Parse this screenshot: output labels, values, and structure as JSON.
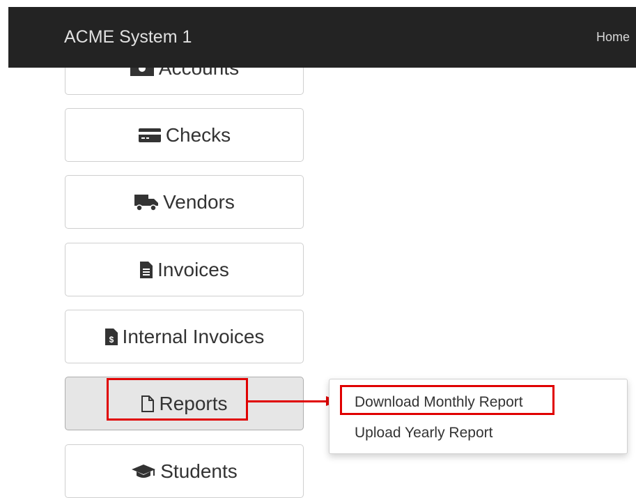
{
  "app": {
    "brand": "ACME System 1"
  },
  "nav": {
    "home": "Home"
  },
  "sidebar": {
    "items": [
      {
        "label": "Accounts",
        "icon": "money-icon"
      },
      {
        "label": "Checks",
        "icon": "credit-card-icon"
      },
      {
        "label": "Vendors",
        "icon": "truck-icon"
      },
      {
        "label": "Invoices",
        "icon": "file-text-icon"
      },
      {
        "label": "Internal Invoices",
        "icon": "file-invoice-dollar-icon"
      },
      {
        "label": "Reports",
        "icon": "file-icon",
        "active": true
      },
      {
        "label": "Students",
        "icon": "graduation-cap-icon"
      }
    ]
  },
  "reports_menu": {
    "items": [
      {
        "label": "Download Monthly Report",
        "highlighted": true
      },
      {
        "label": "Upload Yearly Report"
      }
    ]
  },
  "colors": {
    "topbar": "#232323",
    "annotation": "#e00000",
    "active_button": "#e6e6e6"
  }
}
